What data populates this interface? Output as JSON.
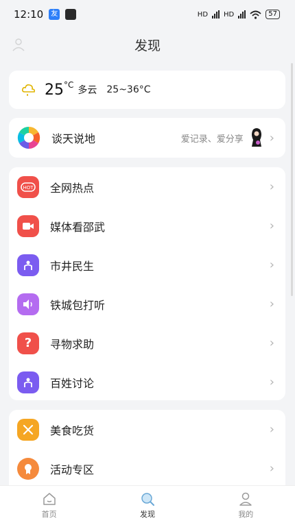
{
  "status": {
    "time": "12:10",
    "badge_text": "友",
    "network_1": "HD",
    "network_2": "HD",
    "battery": "57"
  },
  "header": {
    "title": "发现"
  },
  "weather": {
    "temp": "25",
    "unit": "°C",
    "condition": "多云",
    "range": "25~36°C"
  },
  "talk": {
    "label": "谈天说地",
    "subtitle": "爱记录、爱分享"
  },
  "list1": [
    {
      "label": "全网热点",
      "icon": "hot-icon",
      "color": "#f0504a"
    },
    {
      "label": "媒体看邵武",
      "icon": "video-icon",
      "color": "#f0504a"
    },
    {
      "label": "市井民生",
      "icon": "people-icon",
      "color": "#7b5cf0"
    },
    {
      "label": "铁城包打听",
      "icon": "speaker-icon",
      "color": "#b46cf0"
    },
    {
      "label": "寻物求助",
      "icon": "question-icon",
      "color": "#f0504a"
    },
    {
      "label": "百姓讨论",
      "icon": "people-icon",
      "color": "#7b5cf0"
    }
  ],
  "list2": [
    {
      "label": "美食吃货",
      "icon": "utensils-icon",
      "color": "#f5a623"
    },
    {
      "label": "活动专区",
      "icon": "badge-icon",
      "color": "#f58a3c"
    }
  ],
  "tabs": {
    "home": "首页",
    "discover": "发现",
    "mine": "我的"
  }
}
